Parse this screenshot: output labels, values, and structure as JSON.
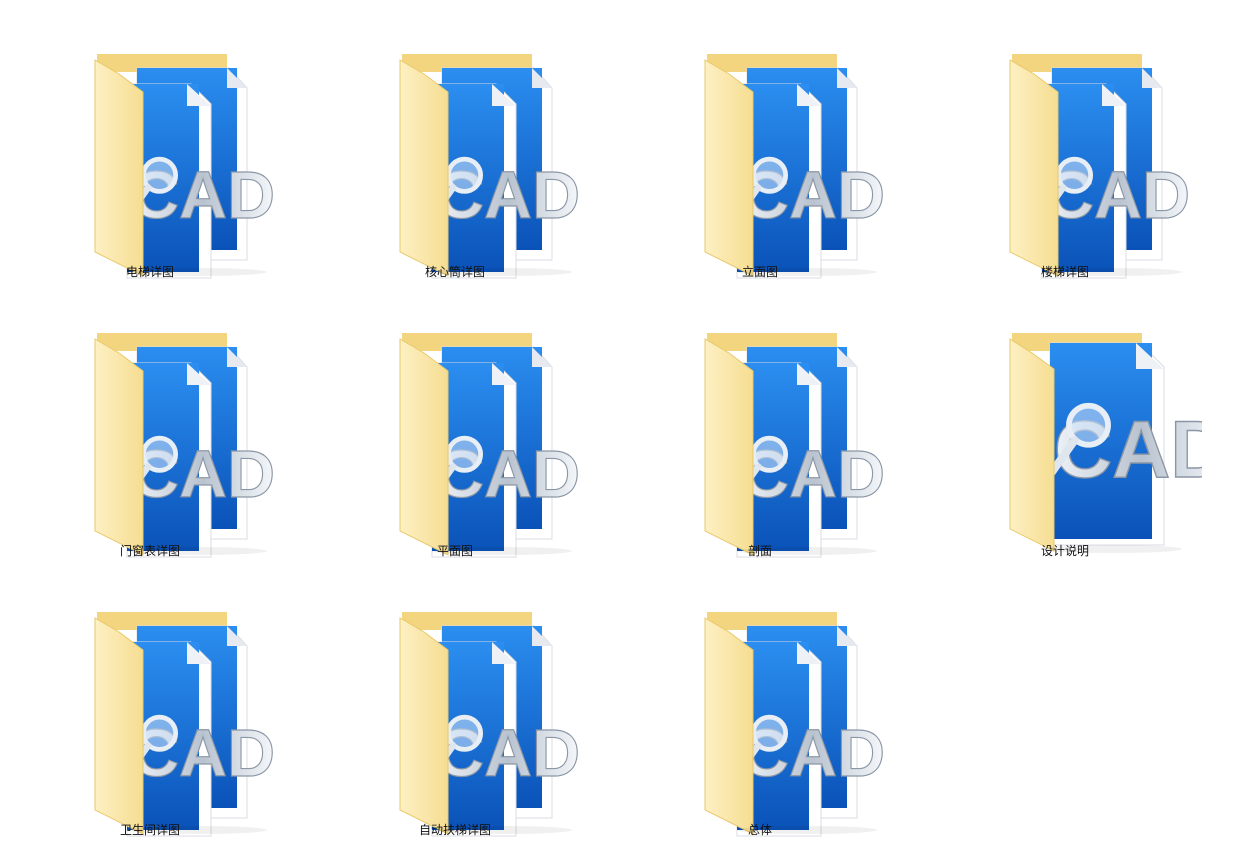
{
  "folders": [
    {
      "name": "电梯详图",
      "icon": "cad-folder-icon"
    },
    {
      "name": "核心筒详图",
      "icon": "cad-folder-icon"
    },
    {
      "name": "立面图",
      "icon": "cad-folder-icon"
    },
    {
      "name": "楼梯详图",
      "icon": "cad-folder-icon"
    },
    {
      "name": "门窗表详图",
      "icon": "cad-folder-icon"
    },
    {
      "name": "平面图",
      "icon": "cad-folder-icon"
    },
    {
      "name": "剖面",
      "icon": "cad-folder-icon"
    },
    {
      "name": "设计说明",
      "icon": "cad-folder-open-icon"
    },
    {
      "name": "卫生间详图",
      "icon": "cad-folder-icon"
    },
    {
      "name": "自动扶梯详图",
      "icon": "cad-folder-icon"
    },
    {
      "name": "总体",
      "icon": "cad-folder-icon"
    }
  ],
  "colors": {
    "folder_tan": "#f6dc8a",
    "folder_light": "#fbe9b0",
    "cad_blue": "#1a73d9",
    "cad_blue_dark": "#0a4fb0",
    "label_text": "#111111",
    "background": "#ffffff"
  }
}
